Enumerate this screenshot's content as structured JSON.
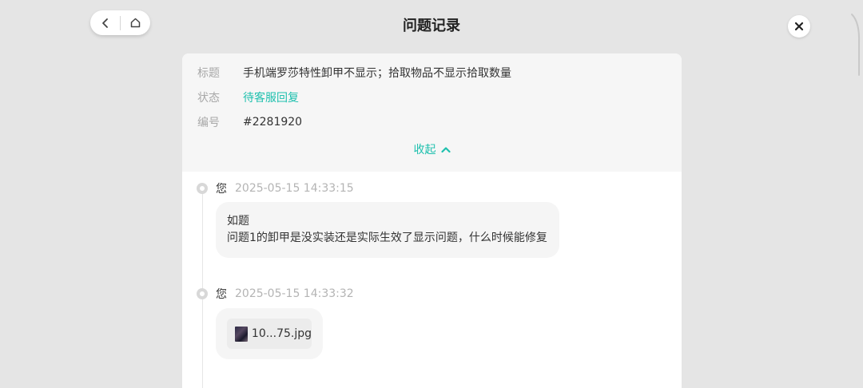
{
  "header": {
    "title": "问题记录"
  },
  "nav": {
    "back_icon": "chevron-left-icon",
    "home_icon": "home-icon",
    "close_icon": "close-icon"
  },
  "ticket": {
    "title_label": "标题",
    "title_value": "手机端罗莎特性卸甲不显示；拾取物品不显示拾取数量",
    "status_label": "状态",
    "status_value": "待客服回复",
    "number_label": "编号",
    "number_value": "#2281920",
    "collapse_label": "收起"
  },
  "messages": [
    {
      "sender": "您",
      "time": "2025-05-15 14:33:15",
      "lines": [
        "如题",
        "问题1的卸甲是没实装还是实际生效了显示问题，什么时候能修复"
      ]
    },
    {
      "sender": "您",
      "time": "2025-05-15 14:33:32",
      "attachment": "10...75.jpg"
    }
  ],
  "colors": {
    "accent": "#1fc0ae",
    "background": "#e5e5e5",
    "panel": "#ffffff",
    "info_bg": "#f6f6f6"
  }
}
